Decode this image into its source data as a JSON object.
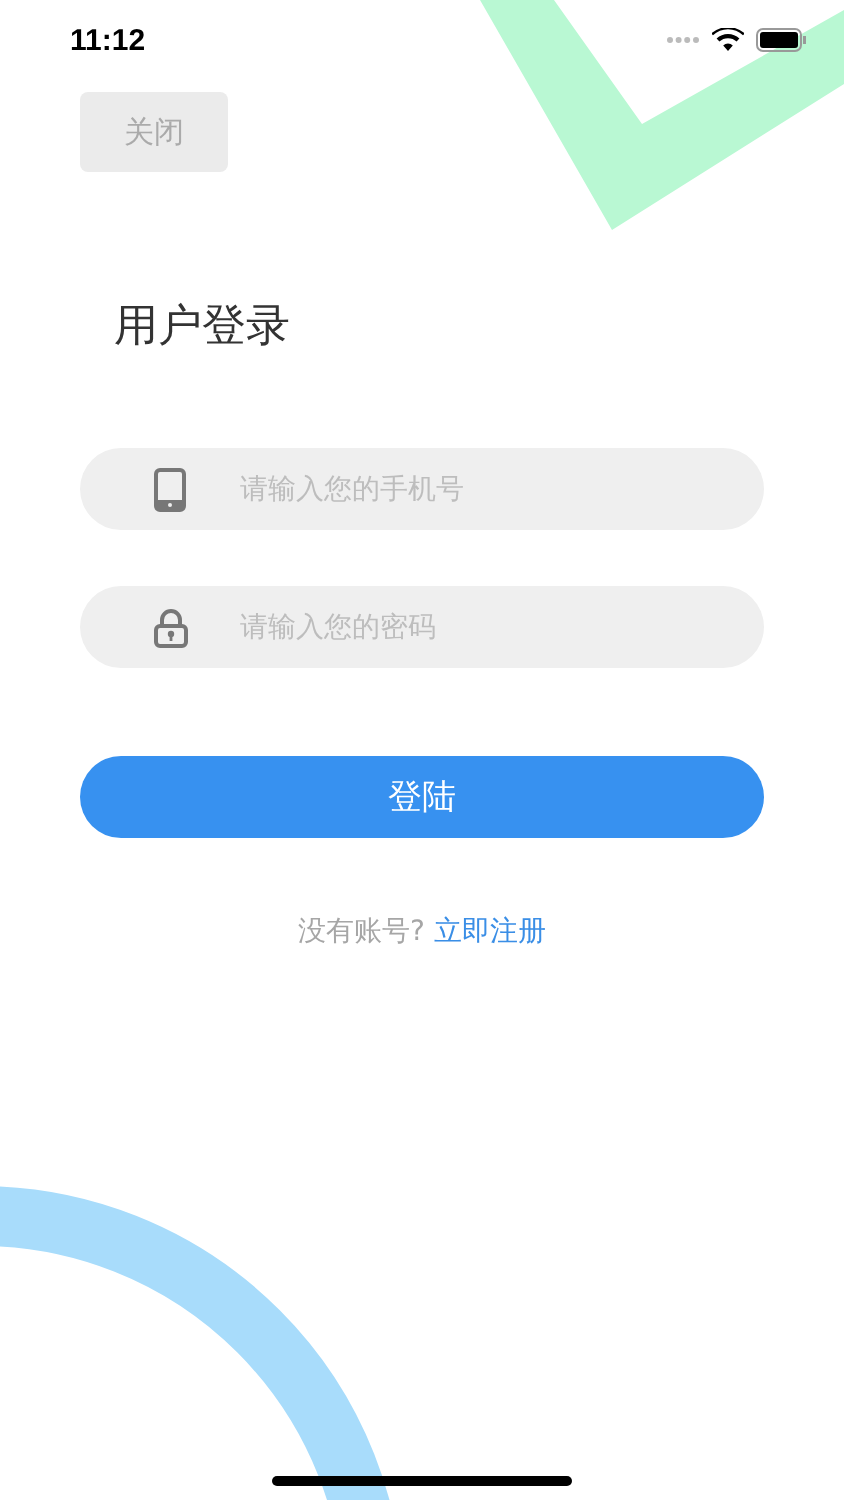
{
  "status_bar": {
    "time": "11:12"
  },
  "close_button": {
    "label": "关闭"
  },
  "title": "用户登录",
  "fields": [
    {
      "kind": "phone",
      "placeholder": "请输入您的手机号"
    },
    {
      "kind": "password",
      "placeholder": "请输入您的密码"
    }
  ],
  "login_button": {
    "label": "登陆"
  },
  "register": {
    "prompt": "没有账号?",
    "link": "立即注册"
  }
}
